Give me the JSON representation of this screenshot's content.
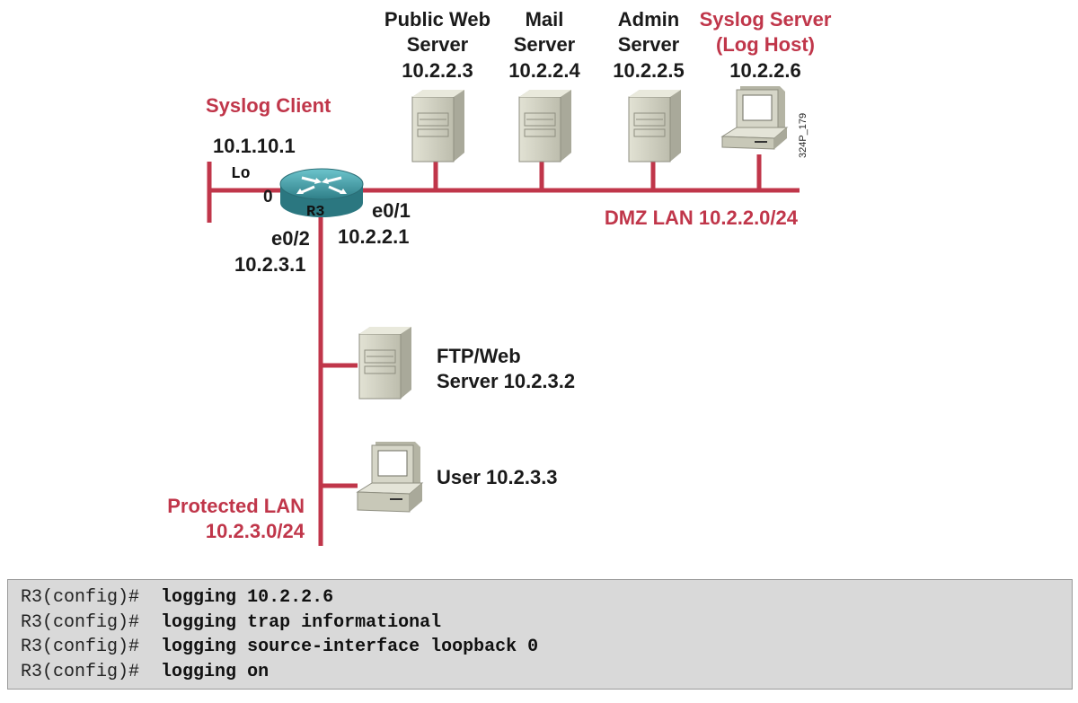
{
  "diagram": {
    "labels": {
      "public_web_line1": "Public Web",
      "public_web_line2": "Server",
      "public_web_ip": "10.2.2.3",
      "mail_line1": "Mail",
      "mail_line2": "Server",
      "mail_ip": "10.2.2.4",
      "admin_line1": "Admin",
      "admin_line2": "Server",
      "admin_ip": "10.2.2.5",
      "syslog_server_line1": "Syslog Server",
      "syslog_server_line2": "(Log Host)",
      "syslog_server_ip": "10.2.2.6",
      "figure_id": "324P_179",
      "syslog_client": "Syslog Client",
      "loopback_ip": "10.1.10.1",
      "lo": "Lo",
      "lo_num": "0",
      "router_name": "R3",
      "e01": "e0/1",
      "e01_ip": "10.2.2.1",
      "e02": "e0/2",
      "e02_ip": "10.2.3.1",
      "dmz_lan": "DMZ LAN 10.2.2.0/24",
      "ftp_line1": "FTP/Web",
      "ftp_line2": "Server 10.2.3.2",
      "user": "User 10.2.3.3",
      "protected_line1": "Protected LAN",
      "protected_line2": "10.2.3.0/24"
    },
    "colors": {
      "link": "#c0364a",
      "router": "#3f9aa3",
      "device": "#cfcfc0"
    }
  },
  "config": {
    "lines": [
      {
        "prompt": "R3(config)#",
        "command": "logging 10.2.2.6"
      },
      {
        "prompt": "R3(config)#",
        "command": "logging trap informational"
      },
      {
        "prompt": "R3(config)#",
        "command": "logging source-interface loopback 0"
      },
      {
        "prompt": "R3(config)#",
        "command": "logging on"
      }
    ]
  }
}
